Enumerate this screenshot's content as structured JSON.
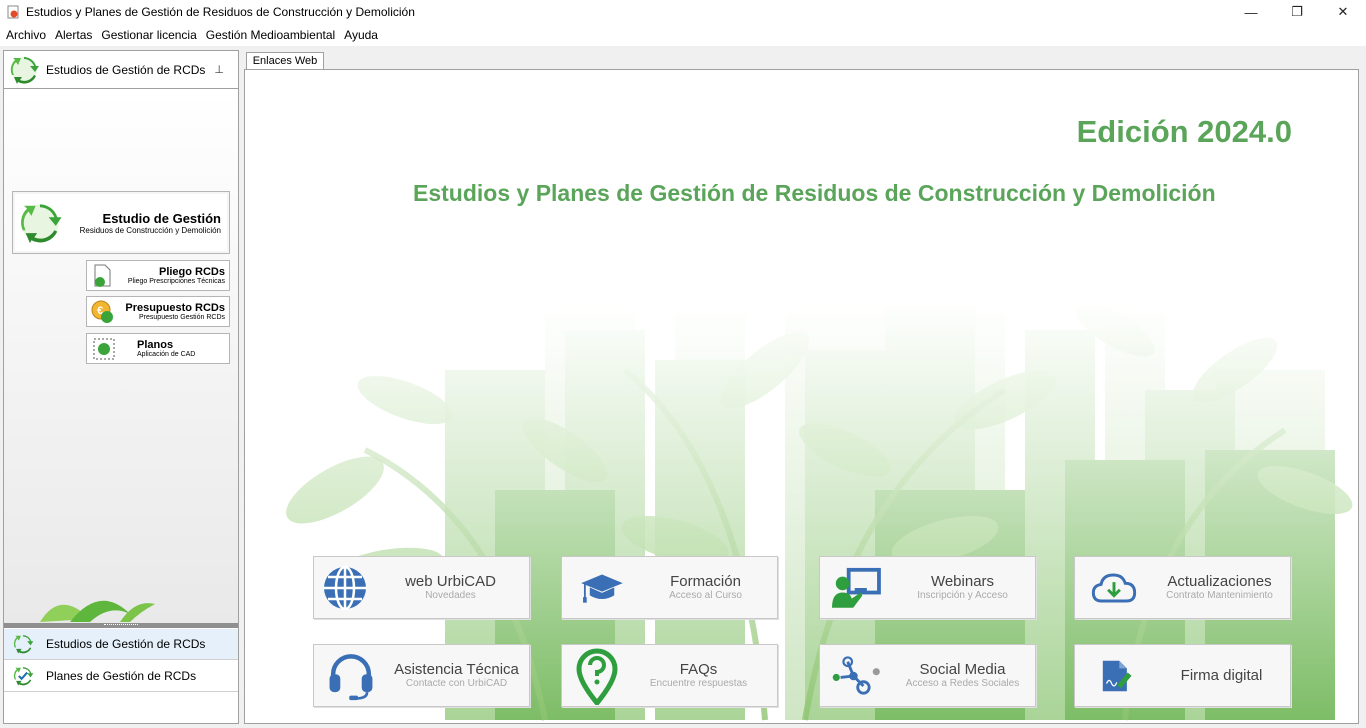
{
  "window": {
    "title": "Estudios y Planes de Gestión de Residuos de Construcción y Demolición",
    "minimize": "—",
    "maximize": "❐",
    "close": "✕"
  },
  "menu": [
    "Archivo",
    "Alertas",
    "Gestionar licencia",
    "Gestión Medioambiental",
    "Ayuda"
  ],
  "left_panel": {
    "header": "Estudios de Gestión de RCDs",
    "pin": "⊥",
    "big_button": {
      "title": "Estudio de Gestión",
      "subtitle": "Residuos de Construcción y Demolición"
    },
    "buttons": [
      {
        "title": "Pliego RCDs",
        "subtitle": "Pliego Prescripciones Técnicas"
      },
      {
        "title": "Presupuesto RCDs",
        "subtitle": "Presupuesto Gestión RCDs"
      },
      {
        "title": "Planos",
        "subtitle": "Aplicación de CAD"
      }
    ],
    "nav": [
      "Estudios de Gestión de RCDs",
      "Planes de Gestión de RCDs"
    ],
    "selected_nav": 0
  },
  "tab": "Enlaces Web",
  "main": {
    "edition": "Edición 2024.0",
    "subtitle": "Estudios y Planes de Gestión de Residuos de Construcción y Demolición",
    "links": [
      {
        "title": "web UrbiCAD",
        "subtitle": "Novedades",
        "icon": "globe-icon"
      },
      {
        "title": "Formación",
        "subtitle": "Acceso al Curso",
        "icon": "graduation-cap-icon"
      },
      {
        "title": "Webinars",
        "subtitle": "Inscripción y Acceso",
        "icon": "presenter-icon"
      },
      {
        "title": "Actualizaciones",
        "subtitle": "Contrato Mantenimiento",
        "icon": "cloud-download-icon"
      },
      {
        "title": "Asistencia Técnica",
        "subtitle": "Contacte con UrbiCAD",
        "icon": "headset-icon"
      },
      {
        "title": "FAQs",
        "subtitle": "Encuentre respuestas",
        "icon": "question-pin-icon"
      },
      {
        "title": "Social Media",
        "subtitle": "Acceso a Redes Sociales",
        "icon": "share-network-icon"
      },
      {
        "title": "Firma digital",
        "subtitle": "",
        "icon": "digital-signature-icon"
      }
    ]
  },
  "colors": {
    "accent_green": "#5aa55a",
    "icon_blue": "#3a6fb5",
    "icon_green": "#2e9e3e"
  }
}
